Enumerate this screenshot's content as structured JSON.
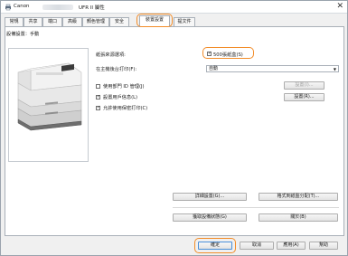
{
  "window": {
    "title_prefix": "Canon",
    "title_suffix": "UFR II 屬性",
    "close_glyph": "✕",
    "app_icon": "printer-icon"
  },
  "tabs": [
    {
      "label": "常規"
    },
    {
      "label": "共享"
    },
    {
      "label": "端口"
    },
    {
      "label": "高級"
    },
    {
      "label": "顏色管理"
    },
    {
      "label": "安全"
    },
    {
      "label": "裝置設置"
    },
    {
      "label": "提文件"
    }
  ],
  "active_tab": "裝置設置",
  "panel": {
    "label": "設備設置：手動"
  },
  "paper_source": {
    "label": "紙張來源選項:",
    "checkbox_label": "500張紙盒(S)",
    "checked": true
  },
  "background_print": {
    "label": "在主機後台打印(F):",
    "value": "自動"
  },
  "options": {
    "dept_id": {
      "label": "使用部門 ID 管理(J)",
      "checked": false,
      "button": "設置(I)..."
    },
    "user_info": {
      "label": "設置用戶信息(L)",
      "checked": true,
      "button": "設置(R)..."
    },
    "secure_print": {
      "label": "允許使用保密打印(C)",
      "checked": true
    }
  },
  "buttons": {
    "detailed": "詳細設置(G)...",
    "format": "格式到紙盤分配(T)...",
    "get_status": "獲取設備狀態(G)",
    "about": "關於(B)"
  },
  "footer": {
    "ok": "確定",
    "cancel": "取消",
    "apply": "應用(A)",
    "help": "幫助"
  },
  "colors": {
    "highlight": "#f28c28",
    "checkbox_check": "#222222"
  }
}
